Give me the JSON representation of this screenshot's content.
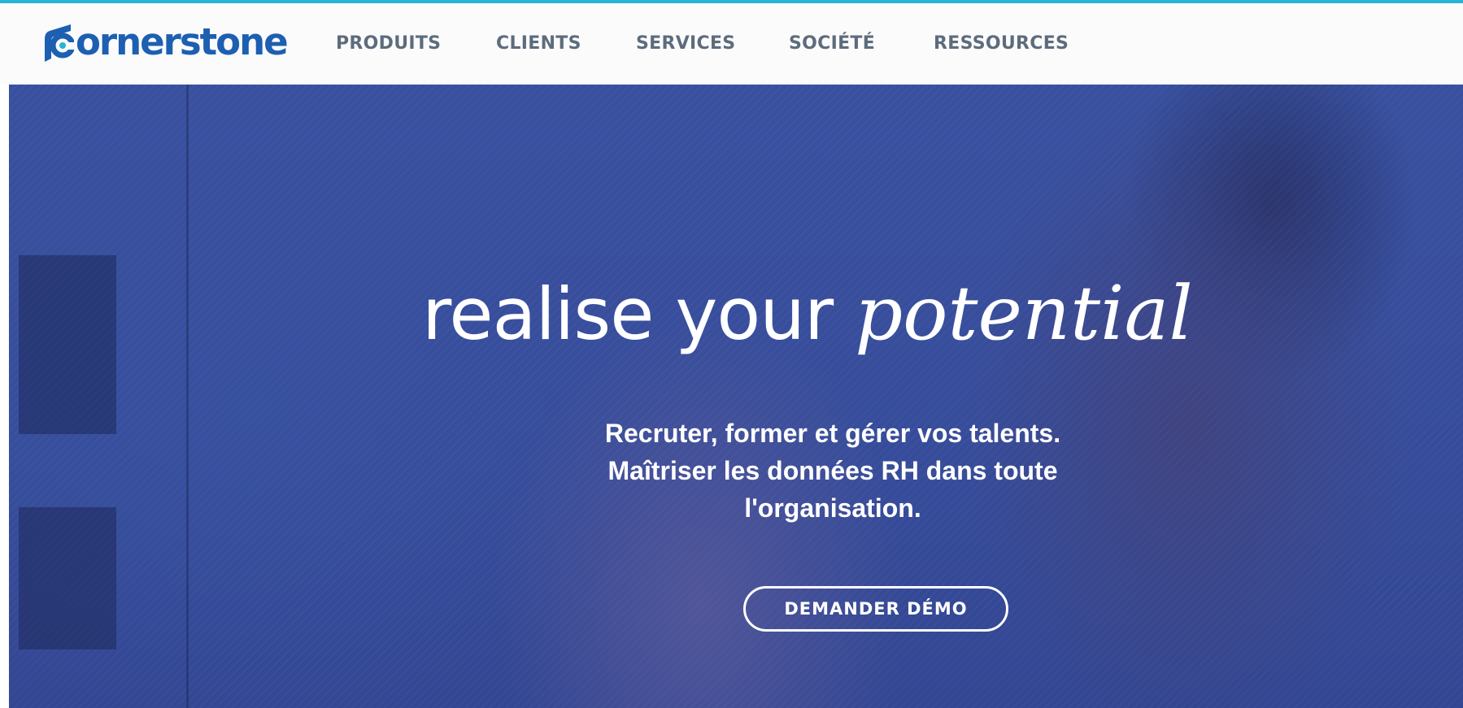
{
  "brand": {
    "logo_text": "ornerstone",
    "logo_full": "Cornerstone",
    "accent_color": "#1d5fb1",
    "topline_color": "#27b4d6"
  },
  "nav": {
    "items": [
      {
        "label": "PRODUITS"
      },
      {
        "label": "CLIENTS"
      },
      {
        "label": "SERVICES"
      },
      {
        "label": "SOCIÉTÉ"
      },
      {
        "label": "RESSOURCES"
      }
    ]
  },
  "hero": {
    "headline_plain": "realise your ",
    "headline_script": "potential",
    "subtext_lines": [
      "Recruter, former et gérer vos talents.",
      "Maîtriser les données RH dans toute",
      "l'organisation."
    ],
    "cta_label": "DEMANDER DÉMO"
  }
}
